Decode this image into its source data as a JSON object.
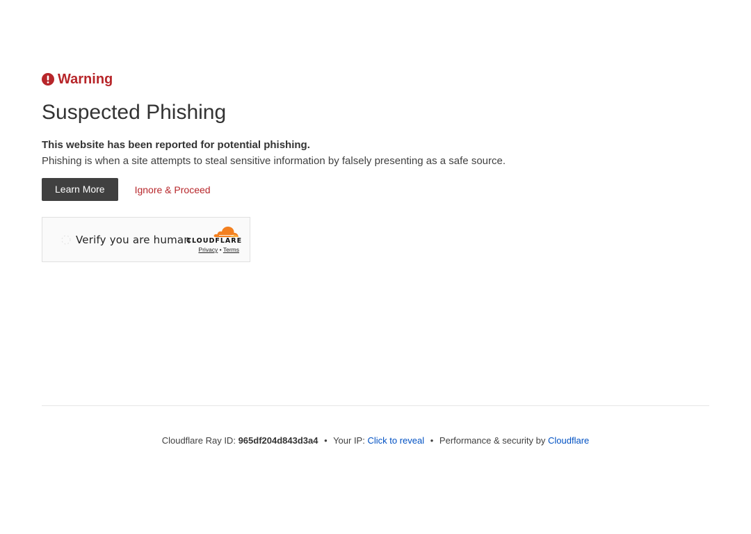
{
  "warning": {
    "icon": "exclamation-circle-icon",
    "label": "Warning",
    "color": "#b7262a"
  },
  "heading": "Suspected Phishing",
  "lead": "This website has been reported for potential phishing.",
  "description": "Phishing is when a site attempts to steal sensitive information by falsely presenting as a safe source.",
  "actions": {
    "learn_more": "Learn More",
    "ignore_proceed": "Ignore & Proceed"
  },
  "turnstile": {
    "label": "Verify you are human",
    "brand": "CLOUDFLARE",
    "privacy": "Privacy",
    "separator": "•",
    "terms": "Terms",
    "brand_color": "#f38020"
  },
  "footer": {
    "ray_label": "Cloudflare Ray ID:",
    "ray_id": "965df204d843d3a4",
    "sep": "•",
    "ip_label": "Your IP:",
    "ip_link": "Click to reveal",
    "perf_label": "Performance & security by",
    "perf_link": "Cloudflare",
    "link_color": "#0051c3"
  }
}
